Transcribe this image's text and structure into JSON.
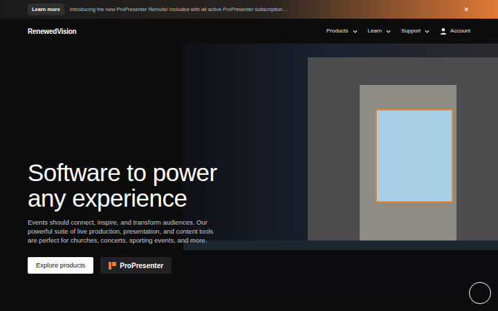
{
  "banner": {
    "button": "Learn more",
    "text": "Introducing the new ProPresenter Remote! Included with all active ProPresenter subscription…",
    "close": "×"
  },
  "nav": {
    "logo": "RenewedVision",
    "items": [
      {
        "label": "Products",
        "kind": "menu"
      },
      {
        "label": "Learn",
        "kind": "menu"
      },
      {
        "label": "Support",
        "kind": "menu"
      },
      {
        "label": "Account",
        "kind": "account"
      }
    ]
  },
  "hero": {
    "title_lines": [
      "Software to power",
      "any experience"
    ],
    "description": "Events should connect, inspire, and transform audiences. Our powerful suite of live production, presentation, and content tools are perfect for churches, concerts, sporting events, and more.",
    "buttons": [
      {
        "label": "Explore products",
        "kind": "primary"
      },
      {
        "label": "ProPresenter",
        "kind": "brand"
      }
    ]
  }
}
